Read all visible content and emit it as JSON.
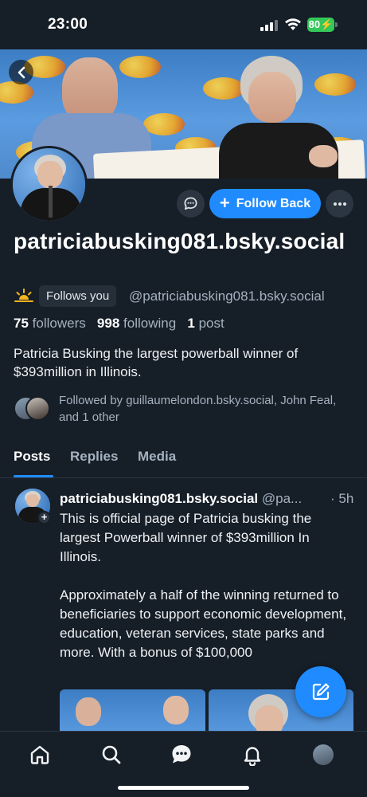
{
  "status_bar": {
    "time": "23:00",
    "battery": "80",
    "icons": [
      "signal-icon",
      "wifi-icon",
      "battery-charging-icon"
    ]
  },
  "header": {
    "back_icon": "chevron-left-icon"
  },
  "actions": {
    "message_icon": "message-bubble-icon",
    "follow_back_label": "Follow Back",
    "more_icon": "ellipsis-icon"
  },
  "profile": {
    "display_name": "patriciabusking081.bsky.social",
    "follows_you_label": "Follows you",
    "handle": "@patriciabusking081.bsky.social",
    "followers_count": "75",
    "followers_label": "followers",
    "following_count": "998",
    "following_label": "following",
    "posts_count": "1",
    "posts_label": "post",
    "bio": "Patricia Busking the largest powerball winner of $393million in Illinois.",
    "followed_by": "Followed by guillaumelondon.bsky.social, John Feal, and 1 other"
  },
  "tabs": [
    {
      "label": "Posts",
      "active": true
    },
    {
      "label": "Replies",
      "active": false
    },
    {
      "label": "Media",
      "active": false
    }
  ],
  "post": {
    "author": "patriciabusking081.bsky.social",
    "handle": "@pa...",
    "time": "· 5h",
    "text": "This is official page of Patricia busking the largest Powerball winner of $393million In Illinois.\n\nApproximately a half of the winning returned to beneficiaries to support economic development, education, veteran services, state parks and more. With a bonus of $100,000"
  },
  "bottom_nav": [
    "home-icon",
    "search-icon",
    "chat-icon",
    "bell-icon",
    "profile-avatar"
  ],
  "colors": {
    "background": "#161e27",
    "accent": "#208bfe",
    "muted_text": "#a5b2c0",
    "chip_bg": "#252f3a"
  }
}
